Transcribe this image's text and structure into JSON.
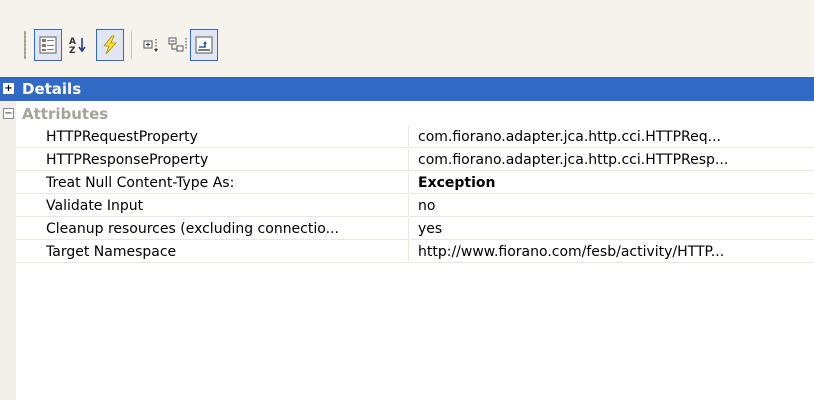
{
  "toolbar": {
    "buttons": [
      {
        "name": "categorized-view",
        "icon": "categorized-icon",
        "active": true
      },
      {
        "name": "alphabetical-sort",
        "icon": "sort-az-icon",
        "active": false
      },
      {
        "name": "events",
        "icon": "lightning-icon",
        "active": true
      },
      {
        "name": "expand-all",
        "icon": "expand-all-icon",
        "active": false
      },
      {
        "name": "collapse-all",
        "icon": "collapse-all-icon",
        "active": false
      },
      {
        "name": "property-pages",
        "icon": "property-pages-icon",
        "active": true
      }
    ]
  },
  "categories": {
    "details": {
      "label": "Details",
      "toggle": "+",
      "selected": true
    },
    "attributes": {
      "label": "Attributes",
      "toggle": "−",
      "selected": false
    }
  },
  "properties": [
    {
      "name": "HTTPRequestProperty",
      "value": "com.fiorano.adapter.jca.http.cci.HTTPReq...",
      "bold": false
    },
    {
      "name": "HTTPResponseProperty",
      "value": "com.fiorano.adapter.jca.http.cci.HTTPResp...",
      "bold": false
    },
    {
      "name": "Treat Null Content-Type As:",
      "value": "Exception",
      "bold": true
    },
    {
      "name": "Validate Input",
      "value": "no",
      "bold": false
    },
    {
      "name": "Cleanup resources (excluding connectio...",
      "value": "yes",
      "bold": false
    },
    {
      "name": "Target Namespace",
      "value": "http://www.fiorano.com/fesb/activity/HTTP...",
      "bold": false
    }
  ],
  "colors": {
    "selection": "#316ac5",
    "toolbar_bg": "#f5f3ec",
    "disabled_text": "#a6a397"
  }
}
